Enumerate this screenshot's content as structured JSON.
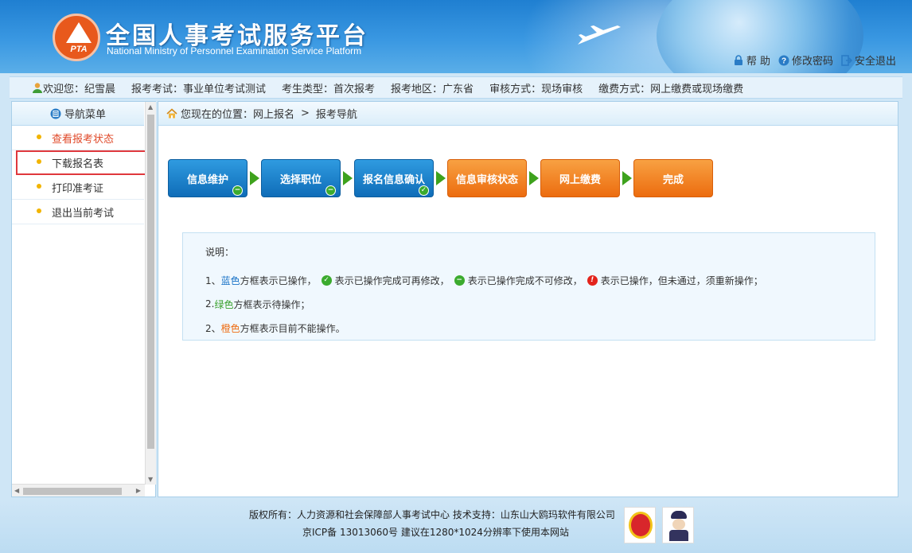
{
  "header": {
    "title": "全国人事考试服务平台",
    "subtitle": "National Ministry of Personnel Examination Service Platform",
    "logo_text": "PTA",
    "links": [
      {
        "label": "帮 助",
        "icon": "lock-icon"
      },
      {
        "label": "修改密码",
        "icon": "help-icon"
      },
      {
        "label": "安全退出",
        "icon": "logout-icon"
      }
    ]
  },
  "infobar": {
    "welcome": "欢迎您：纪雪晨",
    "exam": "报考考试：事业单位考试测试",
    "candidate_type": "考生类型：首次报考",
    "region": "报考地区：广东省",
    "review": "审核方式：现场审核",
    "payment": "缴费方式：网上缴费或现场缴费"
  },
  "sidebar": {
    "title": "导航菜单",
    "items": [
      {
        "label": "查看报考状态"
      },
      {
        "label": "下载报名表"
      },
      {
        "label": "打印准考证"
      },
      {
        "label": "退出当前考试"
      }
    ]
  },
  "breadcrumb": {
    "prefix": "您现在的位置：网上报名",
    "separator": ">",
    "current": "报考导航"
  },
  "steps": [
    {
      "label": "信息维护",
      "color": "blue",
      "badge": "minus"
    },
    {
      "label": "选择职位",
      "color": "blue",
      "badge": "minus"
    },
    {
      "label": "报名信息确认",
      "color": "blue",
      "badge": "check"
    },
    {
      "label": "信息审核状态",
      "color": "orange",
      "badge": ""
    },
    {
      "label": "网上缴费",
      "color": "orange",
      "badge": ""
    },
    {
      "label": "完成",
      "color": "orange",
      "badge": ""
    }
  ],
  "explain": {
    "title": "说明：",
    "line1_prefix": "1、",
    "line1_color": "蓝色",
    "line1_text": "方框表示已操作，",
    "icon1_text": "表示已操作完成可再修改，",
    "icon2_text": "表示已操作完成不可修改，",
    "icon3_text": "表示已操作，但未通过，须重新操作；",
    "line2_prefix": "2. ",
    "line2_color": "绿色",
    "line2_text": "方框表示待操作；",
    "line3_prefix": "2、",
    "line3_color": "橙色",
    "line3_text": "方框表示目前不能操作。"
  },
  "footer": {
    "line1": "版权所有：人力资源和社会保障部人事考试中心  技术支持：山东山大鸥玛软件有限公司",
    "line2": "京ICP备 13013060号  建议在1280*1024分辨率下使用本网站"
  },
  "colors": {
    "accent_blue": "#1a73c7",
    "step_blue": "#0f6db8",
    "step_orange": "#ec6c0f",
    "highlight": "#e0383d"
  }
}
